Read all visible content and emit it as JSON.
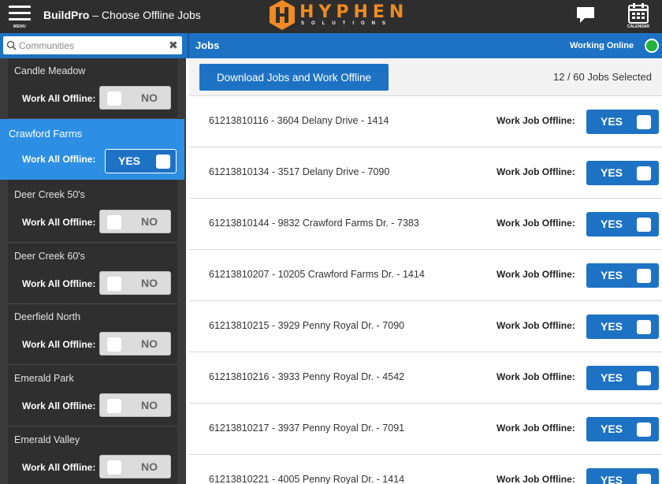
{
  "header": {
    "menu_label": "MENU",
    "app_name": "BuildPro",
    "separator": " – ",
    "page_title": "Choose Offline Jobs",
    "logo_word": "HYPHEN",
    "logo_sub": "SOLUTIONS",
    "calendar_label": "CALENDAR"
  },
  "search": {
    "placeholder": "Communities",
    "value": ""
  },
  "jobs_header": {
    "title": "Jobs",
    "status_text": "Working Online",
    "status_color": "#22b33a"
  },
  "communities": [
    {
      "name": "Candle Meadow",
      "label": "Work All Offline:",
      "toggle": "NO",
      "active": false
    },
    {
      "name": "Crawford Farms",
      "label": "Work All Offline:",
      "toggle": "YES",
      "active": true
    },
    {
      "name": "Deer Creek 50's",
      "label": "Work All Offline:",
      "toggle": "NO",
      "active": false
    },
    {
      "name": "Deer Creek 60's",
      "label": "Work All Offline:",
      "toggle": "NO",
      "active": false
    },
    {
      "name": "Deerfield North",
      "label": "Work All Offline:",
      "toggle": "NO",
      "active": false
    },
    {
      "name": "Emerald Park",
      "label": "Work All Offline:",
      "toggle": "NO",
      "active": false
    },
    {
      "name": "Emerald Valley",
      "label": "Work All Offline:",
      "toggle": "NO",
      "active": false
    }
  ],
  "toolbar": {
    "download_label": "Download Jobs and Work Offline",
    "selected_count": "12 / 60 Jobs Selected"
  },
  "jobs": [
    {
      "name": "61213810116 - 3604 Delany Drive - 1414",
      "label": "Work Job Offline:",
      "toggle": "YES"
    },
    {
      "name": "61213810134 - 3517 Delany Drive - 7090",
      "label": "Work Job Offline:",
      "toggle": "YES"
    },
    {
      "name": "61213810144 - 9832 Crawford Farms Dr. - 7383",
      "label": "Work Job Offline:",
      "toggle": "YES"
    },
    {
      "name": "61213810207 - 10205 Crawford Farms Dr. - 1414",
      "label": "Work Job Offline:",
      "toggle": "YES"
    },
    {
      "name": "61213810215 - 3929 Penny Royal Dr. - 7090",
      "label": "Work Job Offline:",
      "toggle": "YES"
    },
    {
      "name": "61213810216 - 3933 Penny Royal Dr. - 4542",
      "label": "Work Job Offline:",
      "toggle": "YES"
    },
    {
      "name": "61213810217 - 3937 Penny Royal Dr. - 7091",
      "label": "Work Job Offline:",
      "toggle": "YES"
    },
    {
      "name": "61213810221 - 4005 Penny Royal Dr. - 1414",
      "label": "Work Job Offline:",
      "toggle": "YES"
    }
  ],
  "colors": {
    "topbar": "#2e2e2e",
    "accent_blue": "#1d72c4",
    "active_blue": "#2d8fe3",
    "logo_orange": "#f08a24"
  }
}
